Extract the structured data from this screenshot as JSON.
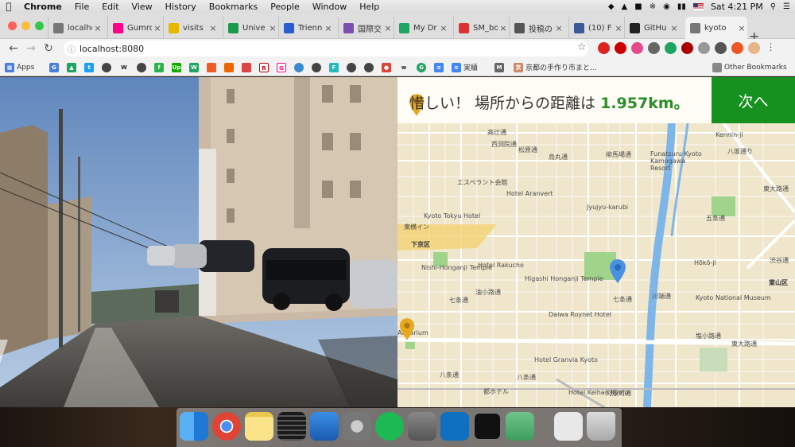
{
  "menubar": {
    "app": "Chrome",
    "items": [
      "File",
      "Edit",
      "View",
      "History",
      "Bookmarks",
      "People",
      "Window",
      "Help"
    ],
    "clock": "Sat 4:21 PM"
  },
  "tabs": [
    {
      "title": "localho",
      "color": "#777"
    },
    {
      "title": "Gumro",
      "color": "#f08"
    },
    {
      "title": "visits",
      "color": "#e6b800"
    },
    {
      "title": "Unive",
      "color": "#1a9a4a"
    },
    {
      "title": "Trienn",
      "color": "#2a5bd0"
    },
    {
      "title": "国際交",
      "color": "#7a4fb0"
    },
    {
      "title": "My Dr",
      "color": "#1fa463"
    },
    {
      "title": "SM_bo",
      "color": "#d33"
    },
    {
      "title": "投稿の",
      "color": "#555"
    },
    {
      "title": "(10) F",
      "color": "#3b5998"
    },
    {
      "title": "GitHu",
      "color": "#222"
    },
    {
      "title": "kyoto",
      "color": "#777"
    }
  ],
  "toolbar": {
    "url": "localhost:8080"
  },
  "bookmarks": {
    "apps": "Apps",
    "jisho": "実績",
    "kyoto": "京都の手作り市まと...",
    "other": "Other Bookmarks"
  },
  "banner": {
    "prefix": "惜しい！ 場所からの距離は ",
    "distance": "1.957km。",
    "next": "次へ"
  },
  "map": {
    "labels": [
      "高辻通",
      "西洞院通",
      "松原通",
      "烏丸通",
      "柳馬場通",
      "Funatsuru Kyoto Kamogawa Resort",
      "Kennin-ji",
      "八坂通り",
      "エスペラント会館",
      "Hotel Aranvert",
      "Jyujyu-karubi",
      "Kyoto Tokyu Hotel",
      "東横イン",
      "五条通",
      "東大路通",
      "下京区",
      "Nishi-Honganji Temple",
      "Hotel Rakucho",
      "Higashi Honganji Temple",
      "Hōkō-ji",
      "渋谷通",
      "東山区",
      "七条通",
      "七条通",
      "川端通",
      "Kyoto National Museum",
      "Daiwa Roynet Hotel",
      "塩小路通",
      "Aquarium",
      "Hotel Granvia Kyoto",
      "八条通",
      "八条通",
      "都ホテル",
      "Hotel Keihan Kyoto",
      "河原町通",
      "東大路通",
      "油小路通"
    ]
  }
}
